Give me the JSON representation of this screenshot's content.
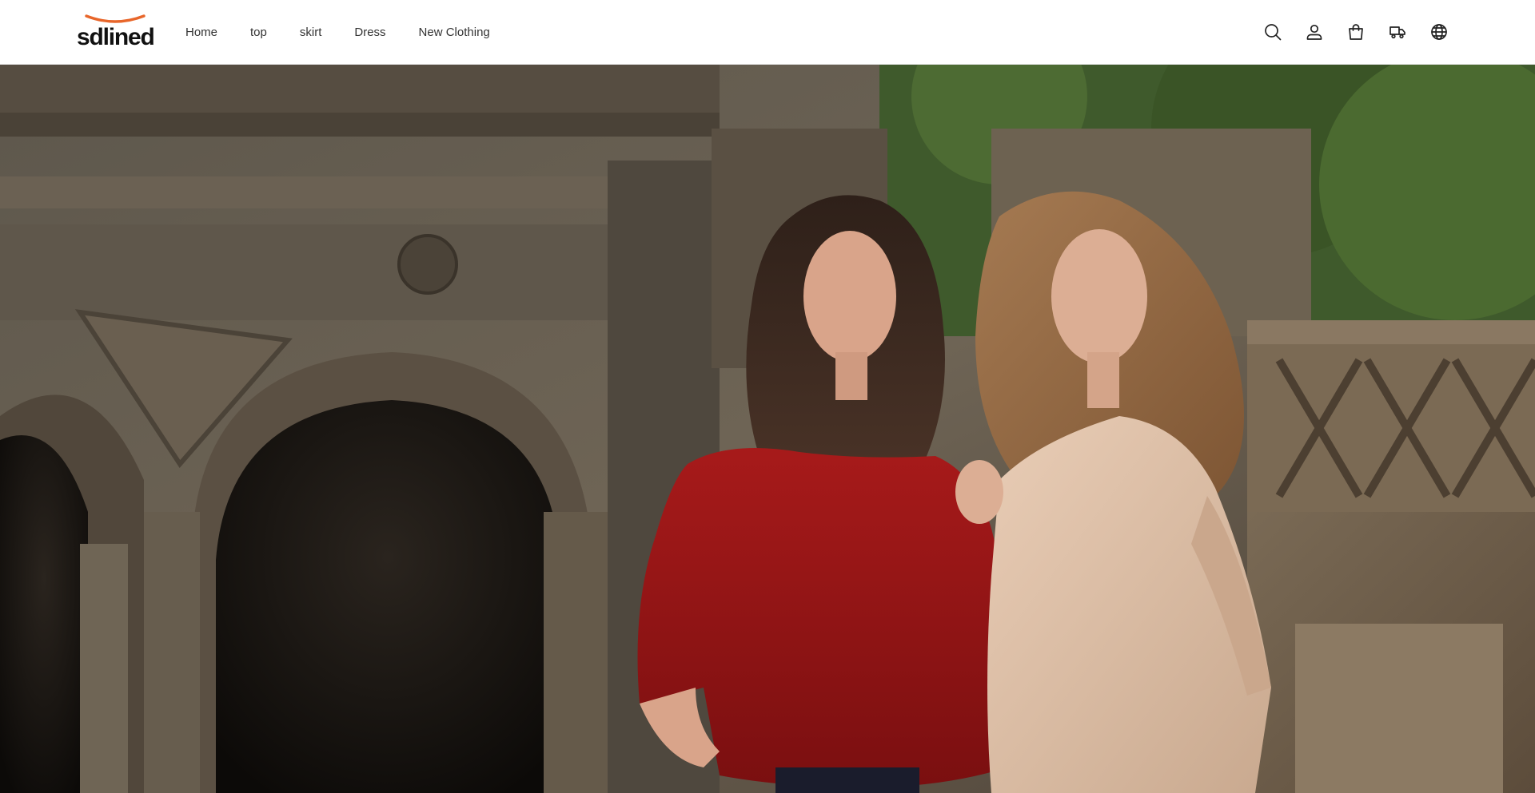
{
  "brand": {
    "name": "sdlined",
    "accent_color": "#E8662A"
  },
  "nav": {
    "items": [
      {
        "label": "Home"
      },
      {
        "label": "top"
      },
      {
        "label": "skirt"
      },
      {
        "label": "Dress"
      },
      {
        "label": "New Clothing"
      }
    ]
  },
  "header_icons": [
    {
      "name": "search-icon"
    },
    {
      "name": "account-icon"
    },
    {
      "name": "cart-icon"
    },
    {
      "name": "order-tracking-icon"
    },
    {
      "name": "language-globe-icon"
    }
  ],
  "hero": {
    "image": "photo of two women in knit sweaters (red and beige) posing by a stone arched terrace"
  }
}
